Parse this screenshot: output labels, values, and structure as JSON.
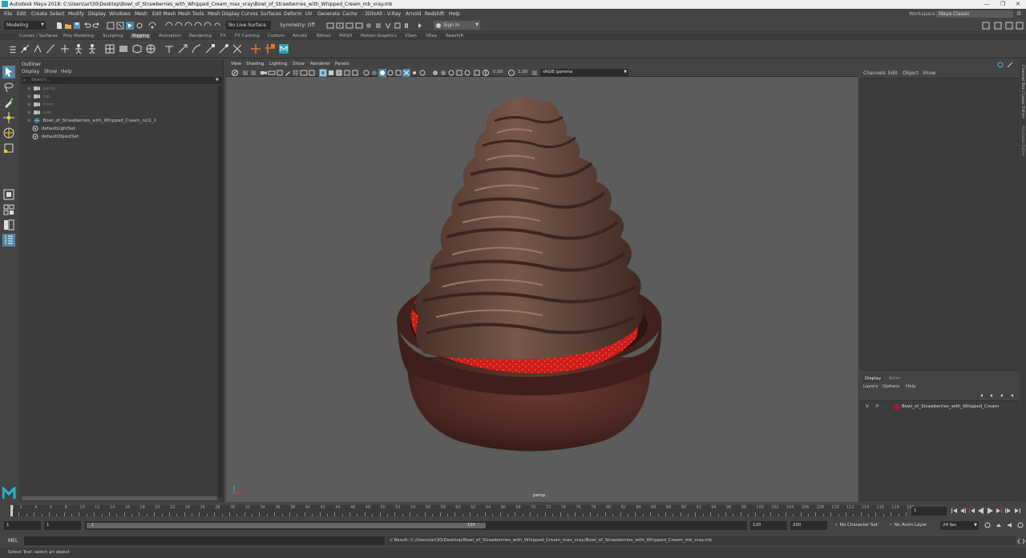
{
  "title_bar": {
    "title": "Autodesk Maya 2018: C:\\Users\\art30\\Desktop\\Bowl_of_Strawberries_with_Whipped_Cream_max_vray\\Bowl_of_Strawberries_with_Whipped_Cream_mb_vray.mb",
    "minimize": "—",
    "maximize": "❐",
    "close": "✕"
  },
  "menu": {
    "items": [
      "File",
      "Edit",
      "Create",
      "Select",
      "Modify",
      "Display",
      "Windows",
      "Mesh",
      "Edit Mesh",
      "Mesh Tools",
      "Mesh Display",
      "Curves",
      "Surfaces",
      "Deform",
      "UV",
      "Generate",
      "Cache",
      "- 3DtoAll -",
      "V-Ray",
      "Arnold",
      "Redshift",
      "Help"
    ],
    "workspace_label": "Workspace :",
    "workspace_value": "Maya Classic"
  },
  "status_line": {
    "mode": "Modeling",
    "live_surface": "No Live Surface",
    "symmetry": "Symmetry: Off",
    "sign_in": "Sign In"
  },
  "shelf_tabs": [
    "Curves / Surfaces",
    "Poly Modeling",
    "Sculpting",
    "Rigging",
    "Animation",
    "Rendering",
    "FX",
    "FX Caching",
    "Custom",
    "Arnold",
    "Bifrost",
    "MASH",
    "Motion Graphics",
    "XGen",
    "VRay",
    "Redshift"
  ],
  "shelf_active_tab": "Rigging",
  "outliner": {
    "title": "Outliner",
    "menu": [
      "Display",
      "Show",
      "Help"
    ],
    "search_placeholder": "Search...",
    "items": [
      {
        "label": "persp",
        "dim": true,
        "type": "camera"
      },
      {
        "label": "top",
        "dim": true,
        "type": "camera"
      },
      {
        "label": "front",
        "dim": true,
        "type": "camera"
      },
      {
        "label": "side",
        "dim": true,
        "type": "camera"
      },
      {
        "label": "Bowl_of_Strawberries_with_Whipped_Cream_ncl1_1",
        "dim": false,
        "type": "group"
      },
      {
        "label": "defaultLightSet",
        "dim": false,
        "type": "set"
      },
      {
        "label": "defaultObjectSet",
        "dim": false,
        "type": "set"
      }
    ]
  },
  "viewport": {
    "menu": [
      "View",
      "Shading",
      "Lighting",
      "Show",
      "Renderer",
      "Panels"
    ],
    "exposure": "0.00",
    "gamma": "1.00",
    "color_space": "sRGB gamma",
    "camera": "persp"
  },
  "channel_box": {
    "menu": [
      "Channels",
      "Edit",
      "Object",
      "Show"
    ]
  },
  "side_strip": {
    "label": "Channel Box / Layer Editor",
    "label2": "Attribute Editor"
  },
  "layer_editor": {
    "tabs": [
      "Display",
      "Anim"
    ],
    "menu": [
      "Layers",
      "Options",
      "Help"
    ],
    "layers": [
      {
        "v": "V",
        "p": "P",
        "name": "Bowl_of_Strawberries_with_Whipped_Cream",
        "color": "#a8162c"
      }
    ]
  },
  "time_slider": {
    "ticks": [
      1,
      2,
      4,
      6,
      8,
      10,
      12,
      14,
      16,
      18,
      20,
      22,
      24,
      26,
      28,
      30,
      32,
      34,
      36,
      38,
      40,
      42,
      44,
      46,
      48,
      50,
      52,
      54,
      56,
      58,
      60,
      62,
      64,
      66,
      68,
      70,
      72,
      74,
      76,
      78,
      80,
      82,
      84,
      86,
      88,
      90,
      92,
      94,
      96,
      98,
      100,
      102,
      104,
      106,
      108,
      110,
      112,
      114,
      116,
      118,
      120
    ],
    "current_frame": "1",
    "min": 1,
    "max": 120
  },
  "range_slider": {
    "start": "1",
    "start_inner": "1",
    "range_start_label": "1",
    "range_end_label": "120",
    "end": "120",
    "end_outer": "200",
    "character_set": "No Character Set",
    "anim_layer": "No Anim Layer",
    "fps": "24 fps"
  },
  "command_line": {
    "lang": "MEL",
    "result": "// Result: C:/Users/art30/Desktop/Bowl_of_Strawberries_with_Whipped_Cream_max_vray/Bowl_of_Strawberries_with_Whipped_Cream_mb_vray.mb"
  },
  "help_line": {
    "text": "Select Tool: select an object"
  },
  "colors": {
    "accent": "#5285a6",
    "chocolate": "#5b3b30",
    "bowl": "#4a2621",
    "strawberry": "#d41f1f",
    "viewport_bg": "#5c5c5c"
  }
}
